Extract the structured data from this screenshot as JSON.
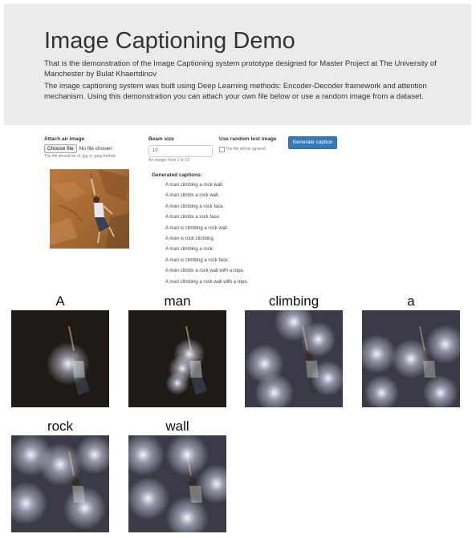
{
  "header": {
    "title": "Image Captioning Demo",
    "intro": "That is the demonstration of the Image Captioning system prototype designed for Master Project at The University of Manchester by Bulat Khaertdinov",
    "description": "The image captioning system was built using Deep Learning methods: Encoder-Decoder framework and attention mechanism. Using this demonstration you can attach your own file below or use a random image from a dataset."
  },
  "form": {
    "attach_label": "Attach an image",
    "choose_file_label": "Choose file",
    "no_file_text": "No file chosen",
    "file_help": "The file should be of .jpg or .jpeg format.",
    "beam_label": "Beam size",
    "beam_value": "10",
    "beam_help": "An integer from 1 to 10",
    "random_label": "Use random test image",
    "random_help": "The file will be ignored",
    "generate_label": "Generate caption"
  },
  "captions": {
    "title": "Generated captions:",
    "items": [
      "A man climbing a rock wall.",
      "A man climbs a rock wall.",
      "A man climbing a rock face.",
      "A man climbs a rock face.",
      "A man is climbing a rock wall.",
      "A man is rock climbing.",
      "A man climbing a rock.",
      "A man is climbing a rock face.",
      "A man climbs a rock wall with a rope.",
      "A man climbing a rock wall with a rope."
    ]
  },
  "attention": {
    "words": [
      "A",
      "man",
      "climbing",
      "a",
      "rock",
      "wall"
    ]
  }
}
